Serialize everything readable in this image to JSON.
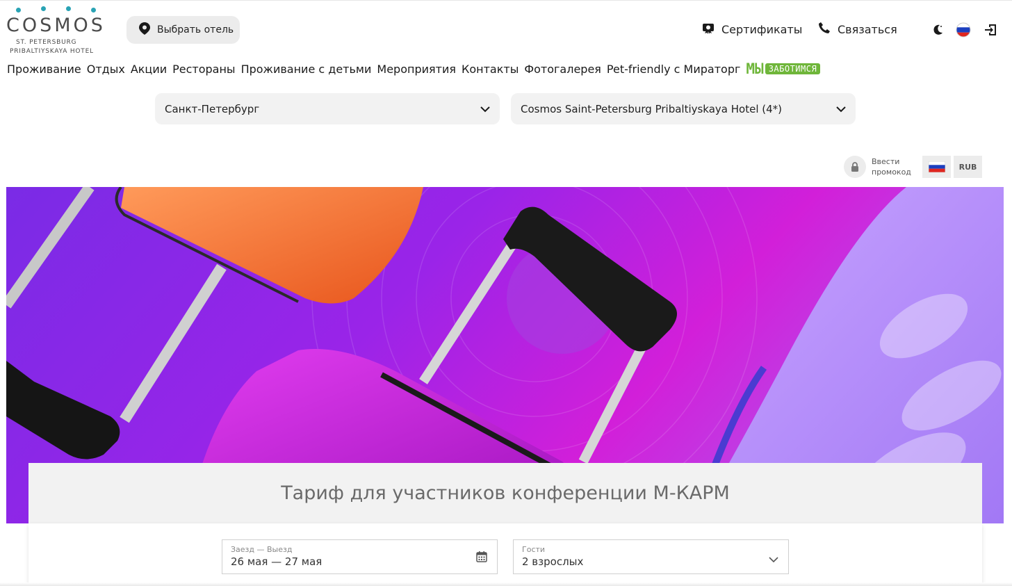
{
  "logo": {
    "word": "COSMOS",
    "line1": "ST. PETERSBURG",
    "line2": "PRIBALTIYSKAYA HOTEL"
  },
  "header": {
    "choose_hotel": "Выбрать отель",
    "certificates": "Сертификаты",
    "contact": "Связаться",
    "icons": [
      "location-pin-icon",
      "gift-certificate-icon",
      "phone-icon",
      "moon-icon",
      "russia-flag-icon",
      "login-icon"
    ]
  },
  "nav": {
    "items": [
      "Проживание",
      "Отдых",
      "Акции",
      "Рестораны",
      "Проживание с детьми",
      "Мероприятия",
      "Контакты",
      "Фотогалерея",
      "Pet-friendly с Мираторг"
    ],
    "care_word": "МЫ",
    "care_tag": "ЗАБОТИМСЯ"
  },
  "selectors": {
    "city": "Санкт-Петербург",
    "hotel": "Cosmos Saint-Petersburg Pribaltiyskaya Hotel (4*)"
  },
  "promo": {
    "line1": "Ввести",
    "line2": "промокод",
    "currency": "RUB"
  },
  "hero": {
    "title": "Тариф для участников конференции М-КАРМ"
  },
  "booking": {
    "dates_label": "Заезд — Выезд",
    "dates_value": "26 мая — 27 мая",
    "guests_label": "Гости",
    "guests_value": "2 взрослых"
  },
  "colors": {
    "brand_teal": "#29a3b4",
    "care_green": "#6fb63a",
    "hero_purple": "#8a2be2",
    "hero_magenta": "#d21fd9"
  }
}
